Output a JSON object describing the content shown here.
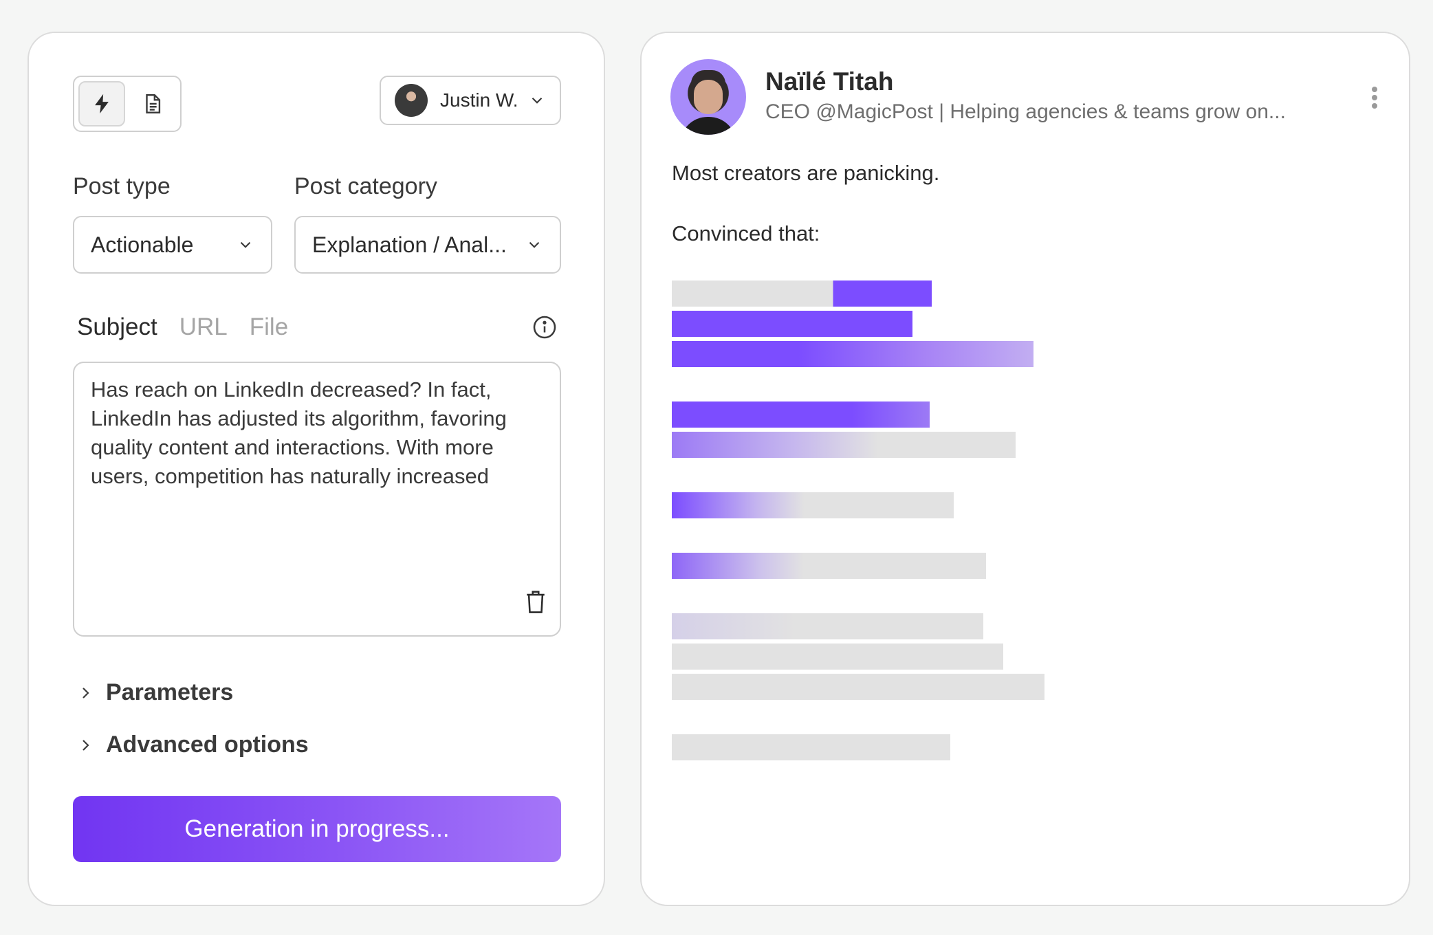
{
  "left": {
    "account": {
      "name": "Justin W."
    },
    "post_type": {
      "label": "Post type",
      "value": "Actionable"
    },
    "post_category": {
      "label": "Post category",
      "value": "Explanation / Anal..."
    },
    "tabs": [
      {
        "label": "Subject"
      },
      {
        "label": "URL"
      },
      {
        "label": "File"
      }
    ],
    "subject_text": "Has reach on LinkedIn decreased? In fact, LinkedIn has adjusted its algorithm, favoring quality content and interactions. With more users, competition has naturally increased",
    "parameters_label": "Parameters",
    "advanced_label": "Advanced options",
    "generate_label": "Generation in progress..."
  },
  "preview": {
    "author_name": "Naïlé Titah",
    "author_headline": "CEO @MagicPost | Helping agencies & teams grow on...",
    "lines": [
      "Most creators are panicking.",
      "Convinced that:"
    ]
  },
  "colors": {
    "accent": "#7c4dff",
    "skeleton": "#e2e2e2"
  },
  "icons": [
    "bolt-icon",
    "document-icon",
    "chevron-down-icon",
    "info-icon",
    "trash-icon",
    "chevron-right-icon",
    "kebab-icon"
  ]
}
